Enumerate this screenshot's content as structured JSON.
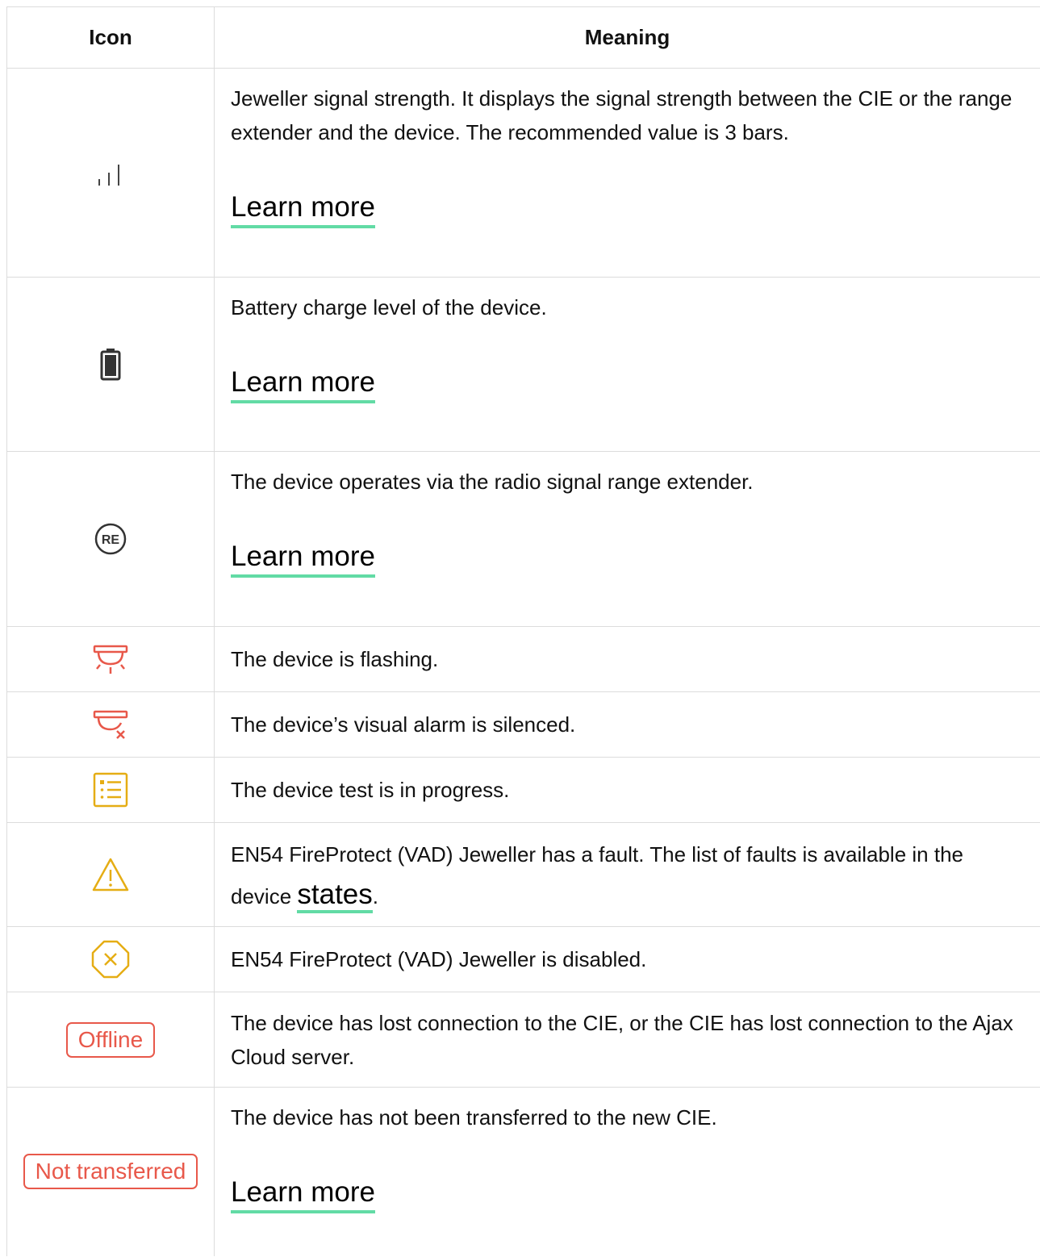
{
  "table": {
    "headers": {
      "icon": "Icon",
      "meaning": "Meaning"
    },
    "rows": [
      {
        "icon": "signal-strength-icon",
        "text": "Jeweller signal strength. It displays the signal strength between the CIE or the range extender and the device. The recommended value is 3 bars.",
        "link": "Learn more"
      },
      {
        "icon": "battery-icon",
        "text": "Battery charge level of the device.",
        "link": "Learn more"
      },
      {
        "icon": "range-extender-icon",
        "icon_text": "RE",
        "text": "The device operates via the radio signal range extender.",
        "link": "Learn more"
      },
      {
        "icon": "flashing-beacon-icon",
        "text": "The device is flashing."
      },
      {
        "icon": "beacon-silenced-icon",
        "text": "The device’s visual alarm is silenced."
      },
      {
        "icon": "test-in-progress-icon",
        "text": "The device test is in progress."
      },
      {
        "icon": "warning-triangle-icon",
        "text_before": "EN54 FireProtect (VAD) Jeweller has a fault. The list of faults is available in the device ",
        "link": "states",
        "text_after": "."
      },
      {
        "icon": "disabled-octagon-icon",
        "text": "EN54 FireProtect (VAD) Jeweller is disabled."
      },
      {
        "icon": "offline-badge",
        "badge": "Offline",
        "text": "The device has lost connection to the CIE, or the CIE has lost connection to the Ajax Cloud server."
      },
      {
        "icon": "not-transferred-badge",
        "badge": "Not transferred",
        "text": "The device has not been transferred to the new CIE.",
        "link": "Learn more"
      }
    ]
  },
  "colors": {
    "link_underline": "#62dba5",
    "alert_red": "#e8584a",
    "warning_yellow": "#e5ad14",
    "icon_dark": "#333333",
    "border": "#dcdcdc"
  }
}
